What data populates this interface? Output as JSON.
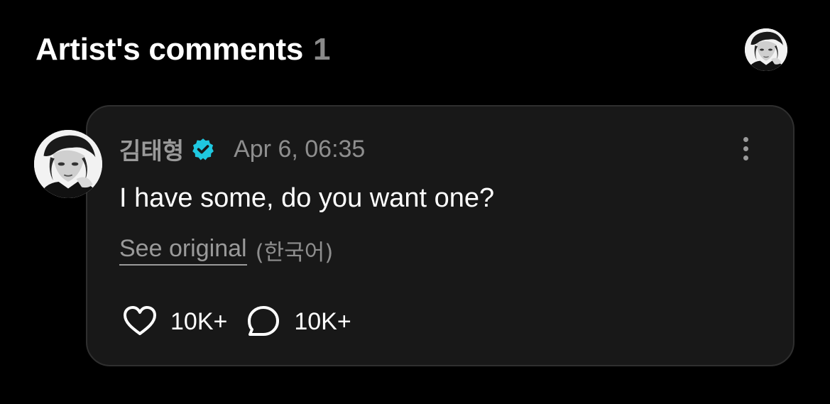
{
  "header": {
    "title": "Artist's comments",
    "count": "1",
    "avatar_icon": "user-avatar-icon"
  },
  "comment": {
    "author": "김태형",
    "verified_icon": "verified-check-icon",
    "verified_color": "#1fc8e0",
    "timestamp": "Apr 6, 06:35",
    "text": "I have some, do you want one?",
    "see_original_label": "See original",
    "language_label": "(한국어)",
    "more_icon": "more-vertical-icon",
    "likes": {
      "icon": "heart-icon",
      "count": "10K+"
    },
    "replies": {
      "icon": "comment-bubble-icon",
      "count": "10K+"
    }
  },
  "colors": {
    "background": "#000000",
    "card_background": "#181818",
    "card_border": "#2f2f2f",
    "muted_text": "#8e8e8e",
    "primary_text": "#ffffff"
  }
}
